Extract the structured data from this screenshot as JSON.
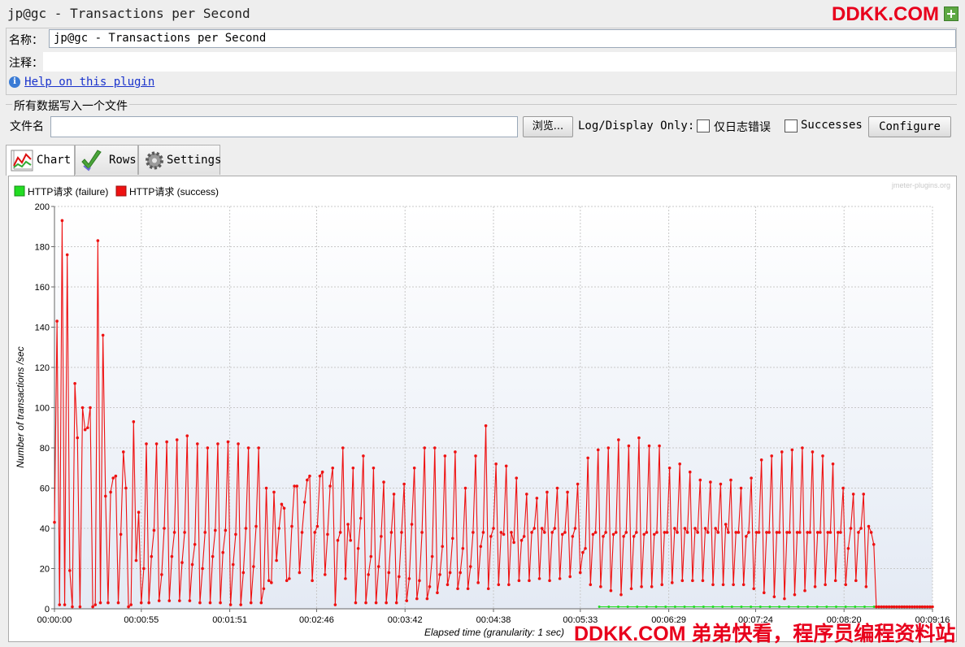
{
  "window": {
    "title": "jp@gc - Transactions per Second",
    "watermark_top": "DDKK.COM",
    "watermark_bottom": "DDKK.COM 弟弟快看，程序员编程资料站"
  },
  "meta": {
    "name_label": "名称：",
    "name_value": "jp@gc - Transactions per Second",
    "comment_label": "注释：",
    "comment_value": "",
    "help_icon": "info-icon",
    "help_link": "Help on this plugin"
  },
  "file_panel": {
    "legend": "所有数据写入一个文件",
    "filename_label": "文件名",
    "filename_value": "",
    "browse_label": "浏览...",
    "log_display_label": "Log/Display Only:",
    "errors_only_label": "仅日志错误",
    "errors_only_checked": false,
    "successes_label": "Successes",
    "successes_checked": false,
    "configure_label": "Configure"
  },
  "tabs": [
    {
      "label": "Chart",
      "icon": "chart-icon",
      "active": true
    },
    {
      "label": "Rows",
      "icon": "checkmark-icon",
      "active": false
    },
    {
      "label": "Settings",
      "icon": "gear-icon",
      "active": false
    }
  ],
  "colors": {
    "failure": "#22dd22",
    "success": "#ee1111",
    "grid": "#c8c8c8"
  },
  "chart_data": {
    "type": "line",
    "credit": "jmeter-plugins.org",
    "xlabel": "Elapsed time (granularity: 1 sec)",
    "ylabel": "Number of transactions /sec",
    "ylim": [
      0,
      200
    ],
    "yticks": [
      0,
      20,
      40,
      60,
      80,
      100,
      120,
      140,
      160,
      180,
      200
    ],
    "xlim": [
      0,
      556
    ],
    "xticks": [
      {
        "t": 0,
        "label": "00:00:00"
      },
      {
        "t": 55,
        "label": "00:00:55"
      },
      {
        "t": 111,
        "label": "00:01:51"
      },
      {
        "t": 166,
        "label": "00:02:46"
      },
      {
        "t": 222,
        "label": "00:03:42"
      },
      {
        "t": 278,
        "label": "00:04:38"
      },
      {
        "t": 333,
        "label": "00:05:33"
      },
      {
        "t": 389,
        "label": "00:06:29"
      },
      {
        "t": 444,
        "label": "00:07:24"
      },
      {
        "t": 500,
        "label": "00:08:20"
      },
      {
        "t": 556,
        "label": "00:09:16"
      }
    ],
    "legend": [
      {
        "name": "HTTP请求 (failure)",
        "color": "#22dd22"
      },
      {
        "name": "HTTP请求 (success)",
        "color": "#ee1111"
      }
    ],
    "legend_position": "top-left",
    "grid": true,
    "series": [
      {
        "name": "HTTP请求 (failure)",
        "color": "#22dd22",
        "t_start": 345,
        "values": [
          1,
          1,
          1,
          1,
          1,
          1,
          1,
          1,
          1,
          1,
          1,
          1,
          1,
          1,
          1,
          1,
          1,
          1,
          1,
          1,
          1,
          1,
          1,
          1,
          1,
          1,
          1,
          1,
          1,
          1,
          1,
          1,
          1,
          1,
          1,
          1,
          1,
          1,
          1,
          1,
          1,
          1,
          1,
          1,
          1,
          1,
          1,
          1,
          1,
          1,
          1,
          1,
          1,
          1,
          1,
          1,
          1,
          1,
          1,
          1,
          1,
          1,
          1,
          1,
          1,
          1,
          1,
          1,
          1,
          1,
          1,
          1,
          1,
          1,
          1,
          1,
          1,
          1,
          1,
          1,
          1,
          1,
          1,
          1,
          1,
          1,
          1,
          1,
          1,
          1,
          1,
          1,
          1,
          1,
          1,
          1,
          1,
          1,
          1,
          1,
          1,
          1,
          1,
          1,
          1,
          1,
          1,
          1,
          1,
          1,
          1,
          1,
          1,
          1,
          1,
          1,
          1,
          1,
          1,
          1,
          1,
          1,
          1,
          1,
          1,
          1,
          1,
          1,
          1,
          1,
          1,
          1,
          1,
          1,
          1,
          1,
          1,
          1,
          1,
          1,
          1,
          1,
          1,
          1,
          1,
          1,
          1,
          1,
          1,
          1,
          1,
          1,
          1,
          1,
          1,
          1,
          1,
          1,
          1,
          1,
          1,
          1,
          1,
          1,
          1,
          1,
          1,
          1,
          1,
          1,
          1,
          1,
          1,
          1,
          1,
          1,
          1,
          1,
          1,
          1,
          1,
          1,
          1,
          1,
          1,
          1,
          1,
          1,
          1,
          1,
          1,
          1,
          1,
          1,
          1,
          1,
          1,
          1,
          1,
          1,
          1,
          1,
          1,
          1,
          1,
          1,
          1,
          1,
          1,
          1,
          1
        ]
      },
      {
        "name": "HTTP请求 (success)",
        "color": "#ee1111",
        "t_start": 0,
        "values": [
          43,
          143,
          2,
          193,
          2,
          176,
          19,
          1,
          112,
          85,
          1,
          100,
          89,
          90,
          100,
          1,
          2,
          183,
          3,
          136,
          56,
          3,
          58,
          65,
          66,
          3,
          37,
          78,
          60,
          1,
          2,
          93,
          24,
          48,
          3,
          20,
          82,
          3,
          26,
          39,
          82,
          4,
          17,
          40,
          83,
          4,
          26,
          38,
          84,
          4,
          23,
          38,
          86,
          4,
          22,
          32,
          82,
          3,
          20,
          38,
          80,
          3,
          26,
          39,
          82,
          3,
          28,
          39,
          83,
          2,
          22,
          37,
          82,
          2,
          18,
          40,
          80,
          3,
          21,
          41,
          80,
          3,
          10,
          60,
          14,
          13,
          58,
          24,
          40,
          52,
          50,
          14,
          15,
          41,
          61,
          61,
          18,
          38,
          53,
          64,
          66,
          14,
          38,
          41,
          66,
          68,
          17,
          37,
          61,
          70,
          2,
          34,
          38,
          80,
          15,
          42,
          34,
          70,
          3,
          30,
          45,
          76,
          3,
          17,
          26,
          70,
          3,
          21,
          36,
          63,
          3,
          18,
          38,
          57,
          3,
          16,
          38,
          62,
          4,
          15,
          42,
          70,
          5,
          14,
          38,
          80,
          5,
          11,
          26,
          80,
          8,
          17,
          31,
          76,
          12,
          18,
          35,
          78,
          10,
          18,
          30,
          60,
          10,
          21,
          38,
          76,
          13,
          31,
          38,
          91,
          10,
          36,
          40,
          72,
          12,
          38,
          37,
          71,
          12,
          38,
          33,
          65,
          14,
          34,
          36,
          57,
          14,
          38,
          40,
          55,
          15,
          40,
          38,
          58,
          14,
          38,
          40,
          60,
          15,
          37,
          38,
          58,
          16,
          36,
          40,
          62,
          18,
          28,
          30,
          75,
          12,
          37,
          38,
          79,
          11,
          36,
          38,
          80,
          9,
          37,
          38,
          84,
          7,
          36,
          38,
          81,
          10,
          36,
          38,
          85,
          11,
          37,
          38,
          81,
          11,
          37,
          38,
          81,
          12,
          38,
          38,
          70,
          13,
          40,
          38,
          72,
          14,
          40,
          38,
          68,
          14,
          40,
          38,
          64,
          14,
          40,
          38,
          63,
          12,
          40,
          38,
          62,
          12,
          42,
          38,
          64,
          12,
          38,
          38,
          60,
          12,
          36,
          38,
          65,
          10,
          38,
          38,
          74,
          8,
          38,
          38,
          76,
          6,
          38,
          38,
          78,
          5,
          38,
          38,
          79,
          7,
          38,
          38,
          80,
          9,
          38,
          38,
          78,
          11,
          38,
          38,
          76,
          12,
          38,
          38,
          72,
          14,
          38,
          38,
          60,
          12,
          30,
          40,
          57,
          14,
          38,
          40,
          57,
          11,
          41,
          38,
          32,
          1,
          1,
          1,
          1,
          1,
          1,
          1,
          1,
          1,
          1,
          1,
          1,
          1,
          1,
          1,
          1,
          1,
          1,
          1,
          1,
          1,
          1,
          1
        ]
      }
    ]
  }
}
